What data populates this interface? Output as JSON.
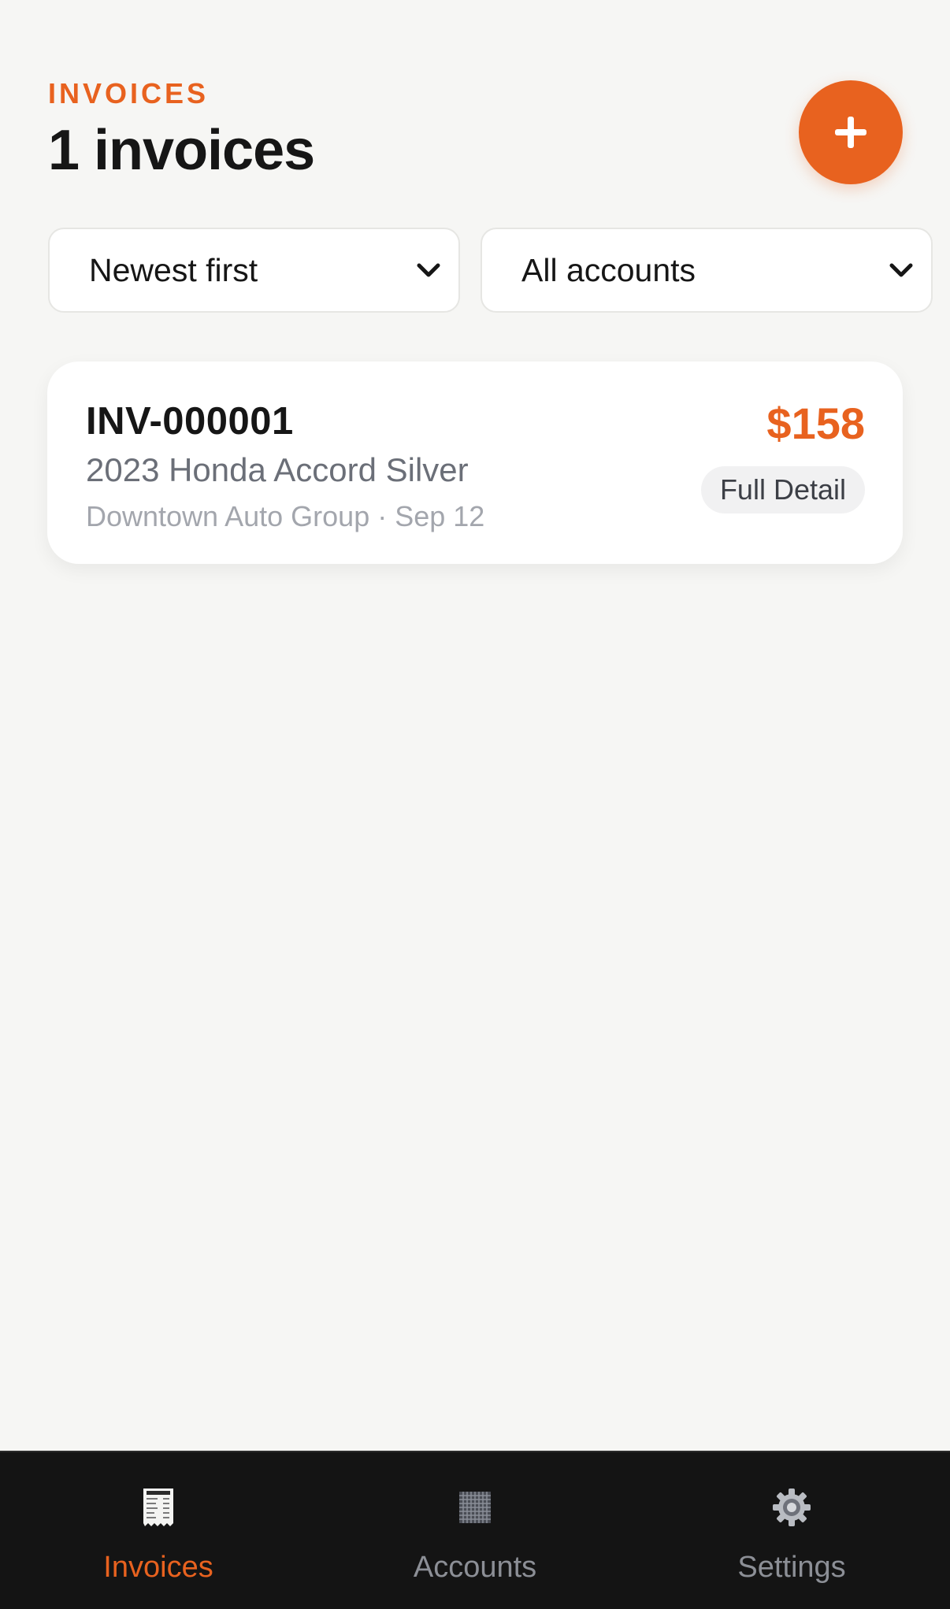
{
  "header": {
    "eyebrow": "INVOICES",
    "title": "1 invoices"
  },
  "fab": {
    "icon": "plus-icon"
  },
  "filters": {
    "sort": {
      "selected": "Newest first",
      "icon": "chevron-down-icon"
    },
    "account": {
      "selected": "All accounts",
      "icon": "chevron-down-icon"
    }
  },
  "invoices": [
    {
      "number": "INV-000001",
      "vehicle": "2023 Honda Accord Silver",
      "meta": "Downtown Auto Group · Sep 12",
      "amount": "$158",
      "service": "Full Detail"
    }
  ],
  "tabbar": {
    "tabs": [
      {
        "label": "Invoices",
        "icon": "receipt-icon",
        "active": true
      },
      {
        "label": "Accounts",
        "icon": "grid-icon",
        "active": false
      },
      {
        "label": "Settings",
        "icon": "gear-icon",
        "active": false
      }
    ]
  },
  "colors": {
    "accent": "#e8621f",
    "background": "#f6f6f4",
    "tabbar": "#141414",
    "muted": "#8c8f96"
  }
}
